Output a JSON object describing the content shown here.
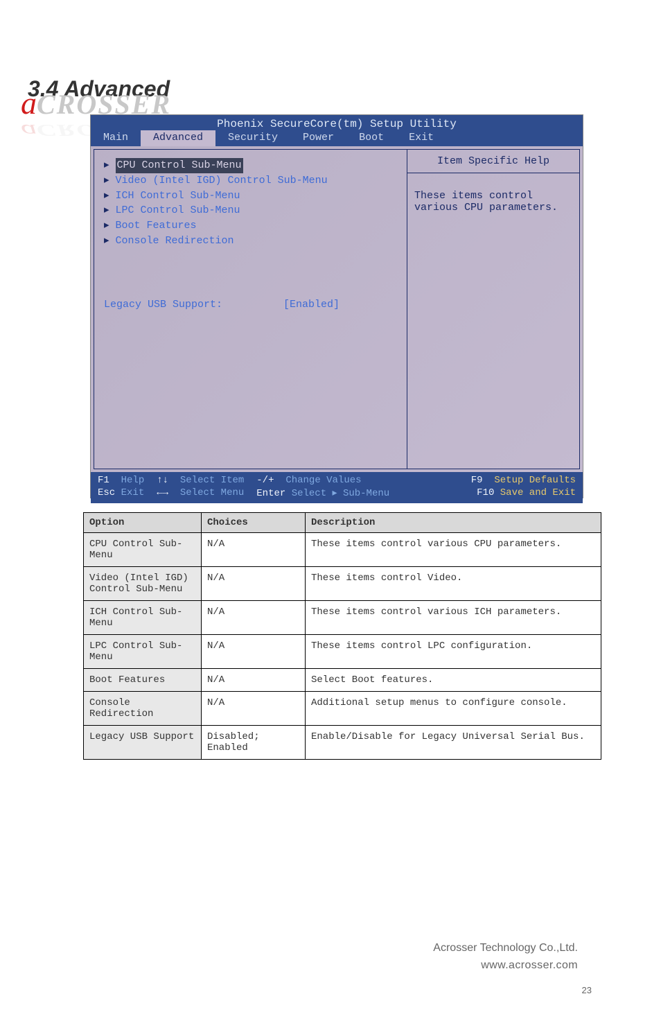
{
  "logo": {
    "text_a": "a",
    "text_rest": "CROSSER"
  },
  "section_title": "3.4 Advanced",
  "bios": {
    "title": "Phoenix SecureCore(tm) Setup Utility",
    "tabs": [
      "Main",
      "Advanced",
      "Security",
      "Power",
      "Boot",
      "Exit"
    ],
    "active_tab": 1,
    "menu_items": [
      "CPU Control Sub-Menu",
      "Video (Intel IGD) Control Sub-Menu",
      "ICH Control Sub-Menu",
      "LPC Control Sub-Menu",
      "Boot Features",
      "Console Redirection"
    ],
    "option": {
      "label": "Legacy USB Support:",
      "value": "[Enabled]"
    },
    "help_title": "Item Specific Help",
    "help_text": "These items control various CPU parameters.",
    "footer": {
      "r1": [
        {
          "k": "F1",
          "a": "Help"
        },
        {
          "k": "↑↓",
          "a": "Select Item"
        },
        {
          "k": "-/+",
          "a": "Change Values"
        },
        {
          "k": "F9",
          "a": "Setup Defaults"
        }
      ],
      "r2": [
        {
          "k": "Esc",
          "a": "Exit"
        },
        {
          "k": "←→",
          "a": "Select Menu"
        },
        {
          "k": "Enter",
          "a": "Select ▸ Sub-Menu"
        },
        {
          "k": "F10",
          "a": "Save and Exit"
        }
      ]
    }
  },
  "table": {
    "headers": [
      "Option",
      "Choices",
      "Description"
    ],
    "rows": [
      [
        "CPU Control Sub-Menu",
        "N/A",
        "These items control various CPU parameters."
      ],
      [
        "Video (Intel IGD) Control Sub-Menu",
        "N/A",
        "These items control Video."
      ],
      [
        "ICH Control Sub-Menu",
        "N/A",
        "These items control various ICH parameters."
      ],
      [
        "LPC Control Sub-Menu",
        "N/A",
        "These items control LPC configuration."
      ],
      [
        "Boot Features",
        "N/A",
        "Select Boot features."
      ],
      [
        "Console Redirection",
        "N/A",
        "Additional setup menus to configure console."
      ],
      [
        "Legacy USB Support",
        "Disabled; Enabled",
        "Enable/Disable for Legacy Universal Serial Bus."
      ]
    ]
  },
  "footer": {
    "company": "Acrosser Technology Co.,Ltd.",
    "site": "www.acrosser.com"
  },
  "page_number": "23"
}
